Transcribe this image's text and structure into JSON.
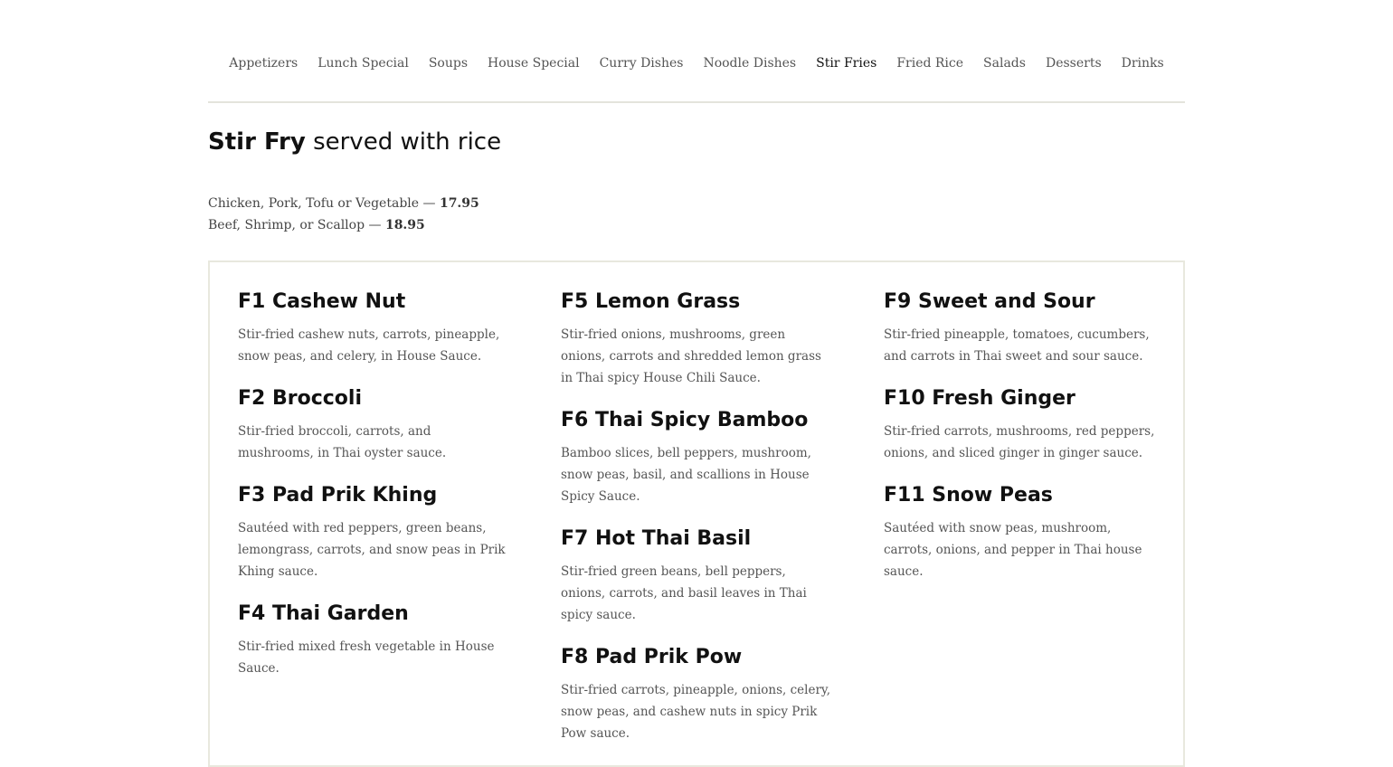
{
  "nav": {
    "items": [
      {
        "label": "Appetizers"
      },
      {
        "label": "Lunch Special"
      },
      {
        "label": "Soups"
      },
      {
        "label": "House Special"
      },
      {
        "label": "Curry Dishes"
      },
      {
        "label": "Noodle Dishes"
      },
      {
        "label": "Stir Fries",
        "active": true
      },
      {
        "label": "Fried Rice"
      },
      {
        "label": "Salads"
      },
      {
        "label": "Desserts"
      },
      {
        "label": "Drinks"
      }
    ]
  },
  "section": {
    "title_bold": "Stir Fry",
    "title_rest": " served with rice",
    "prices": [
      {
        "text": "Chicken, Pork, Tofu or Vegetable — ",
        "price": "17.95"
      },
      {
        "text": "Beef, Shrimp, or Scallop — ",
        "price": "18.95"
      }
    ]
  },
  "columns": [
    [
      {
        "name": "F1 Cashew Nut",
        "desc": "Stir-fried cashew nuts, carrots, pineapple, snow peas, and celery, in House Sauce."
      },
      {
        "name": "F2 Broccoli",
        "desc": "Stir-fried broccoli, carrots, and mushrooms, in Thai oyster sauce."
      },
      {
        "name": "F3 Pad Prik Khing",
        "desc": "Sautéed with red peppers, green beans, lemongrass, carrots, and snow peas in Prik Khing sauce."
      },
      {
        "name": "F4 Thai Garden",
        "desc": "Stir-fried mixed fresh vegetable in House Sauce."
      }
    ],
    [
      {
        "name": "F5 Lemon Grass",
        "desc": "Stir-fried onions, mushrooms, green onions, carrots and shredded lemon grass in Thai spicy House Chili Sauce."
      },
      {
        "name": "F6 Thai Spicy Bamboo",
        "desc": "Bamboo slices, bell peppers, mushroom, snow peas, basil, and scallions in House Spicy Sauce."
      },
      {
        "name": "F7 Hot Thai Basil",
        "desc": "Stir-fried green beans, bell peppers, onions, carrots, and basil leaves in Thai spicy sauce."
      },
      {
        "name": "F8 Pad Prik Pow",
        "desc": "Stir-fried carrots, pineapple, onions, celery, snow peas, and cashew nuts in spicy Prik Pow sauce."
      }
    ],
    [
      {
        "name": "F9 Sweet and Sour",
        "desc": "Stir-fried pineapple, tomatoes, cucumbers, and carrots in Thai sweet and sour sauce."
      },
      {
        "name": "F10 Fresh Ginger",
        "desc": "Stir-fried carrots, mushrooms, red peppers, onions, and sliced ginger in ginger sauce."
      },
      {
        "name": "F11 Snow Peas",
        "desc": "Sautéed with snow peas, mushroom, carrots, onions, and pepper in Thai house sauce."
      }
    ]
  ]
}
